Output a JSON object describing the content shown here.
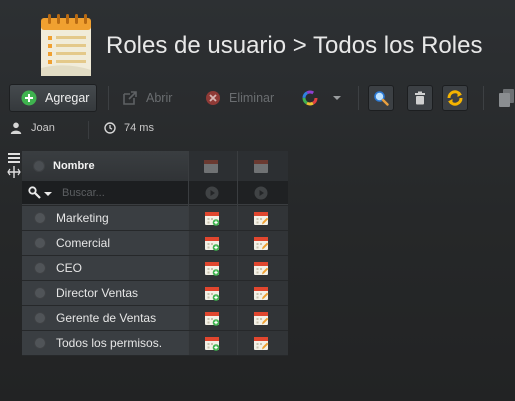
{
  "header": {
    "title": "Roles de usuario > Todos los Roles",
    "logo_icon": "calendar-notepad-icon"
  },
  "toolbar": {
    "add_label": "Agregar",
    "open_label": "Abrir",
    "delete_label": "Eliminar",
    "icons": {
      "add": "plus-circle-icon",
      "open": "external-link-icon",
      "delete": "x-circle-icon",
      "color": "color-wheel-icon",
      "search": "search-icon",
      "trash": "trash-icon",
      "refresh": "refresh-icon",
      "copy": "copy-icon"
    },
    "colors": {
      "add_icon": "#3fb34f",
      "delete_icon": "#c9443d",
      "refresh": "#f5b400"
    }
  },
  "status": {
    "user": "Joan",
    "timing": "74 ms"
  },
  "grid": {
    "column_name": "Nombre",
    "search_placeholder": "Buscar...",
    "rows": [
      {
        "name": "Marketing"
      },
      {
        "name": "Comercial"
      },
      {
        "name": "CEO"
      },
      {
        "name": "Director Ventas"
      },
      {
        "name": "Gerente de Ventas"
      },
      {
        "name": "Todos los permisos."
      }
    ]
  }
}
